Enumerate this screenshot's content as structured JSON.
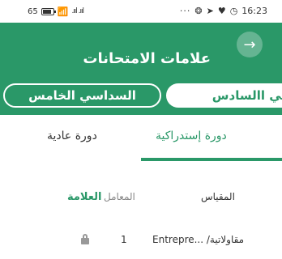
{
  "status_bar": {
    "battery_text": "65",
    "wifi_icon": "wifi-icon",
    "signal_text": ".ııl .ııl",
    "overflow_dots": "···",
    "time": "16:23"
  },
  "header": {
    "title": "علامات الامتحانات",
    "back_icon": "arrow-right-icon",
    "back_glyph": "→",
    "color": "#2a9868"
  },
  "semesters": {
    "items": [
      {
        "label": "السداسي الخامس",
        "selected": false
      },
      {
        "label": "داسي االسادس",
        "selected": true
      }
    ]
  },
  "tabs": [
    {
      "label": "دورة عادية",
      "active": false
    },
    {
      "label": "دورة إستدراكية",
      "active": true
    }
  ],
  "table": {
    "columns": {
      "measure": "المقياس",
      "coefficient": "المعامل",
      "grade": "العلامة"
    },
    "rows": [
      {
        "course": "Entrepre... /مقاولاتية",
        "coefficient": "1",
        "grade_icon": "lock-icon"
      }
    ]
  }
}
